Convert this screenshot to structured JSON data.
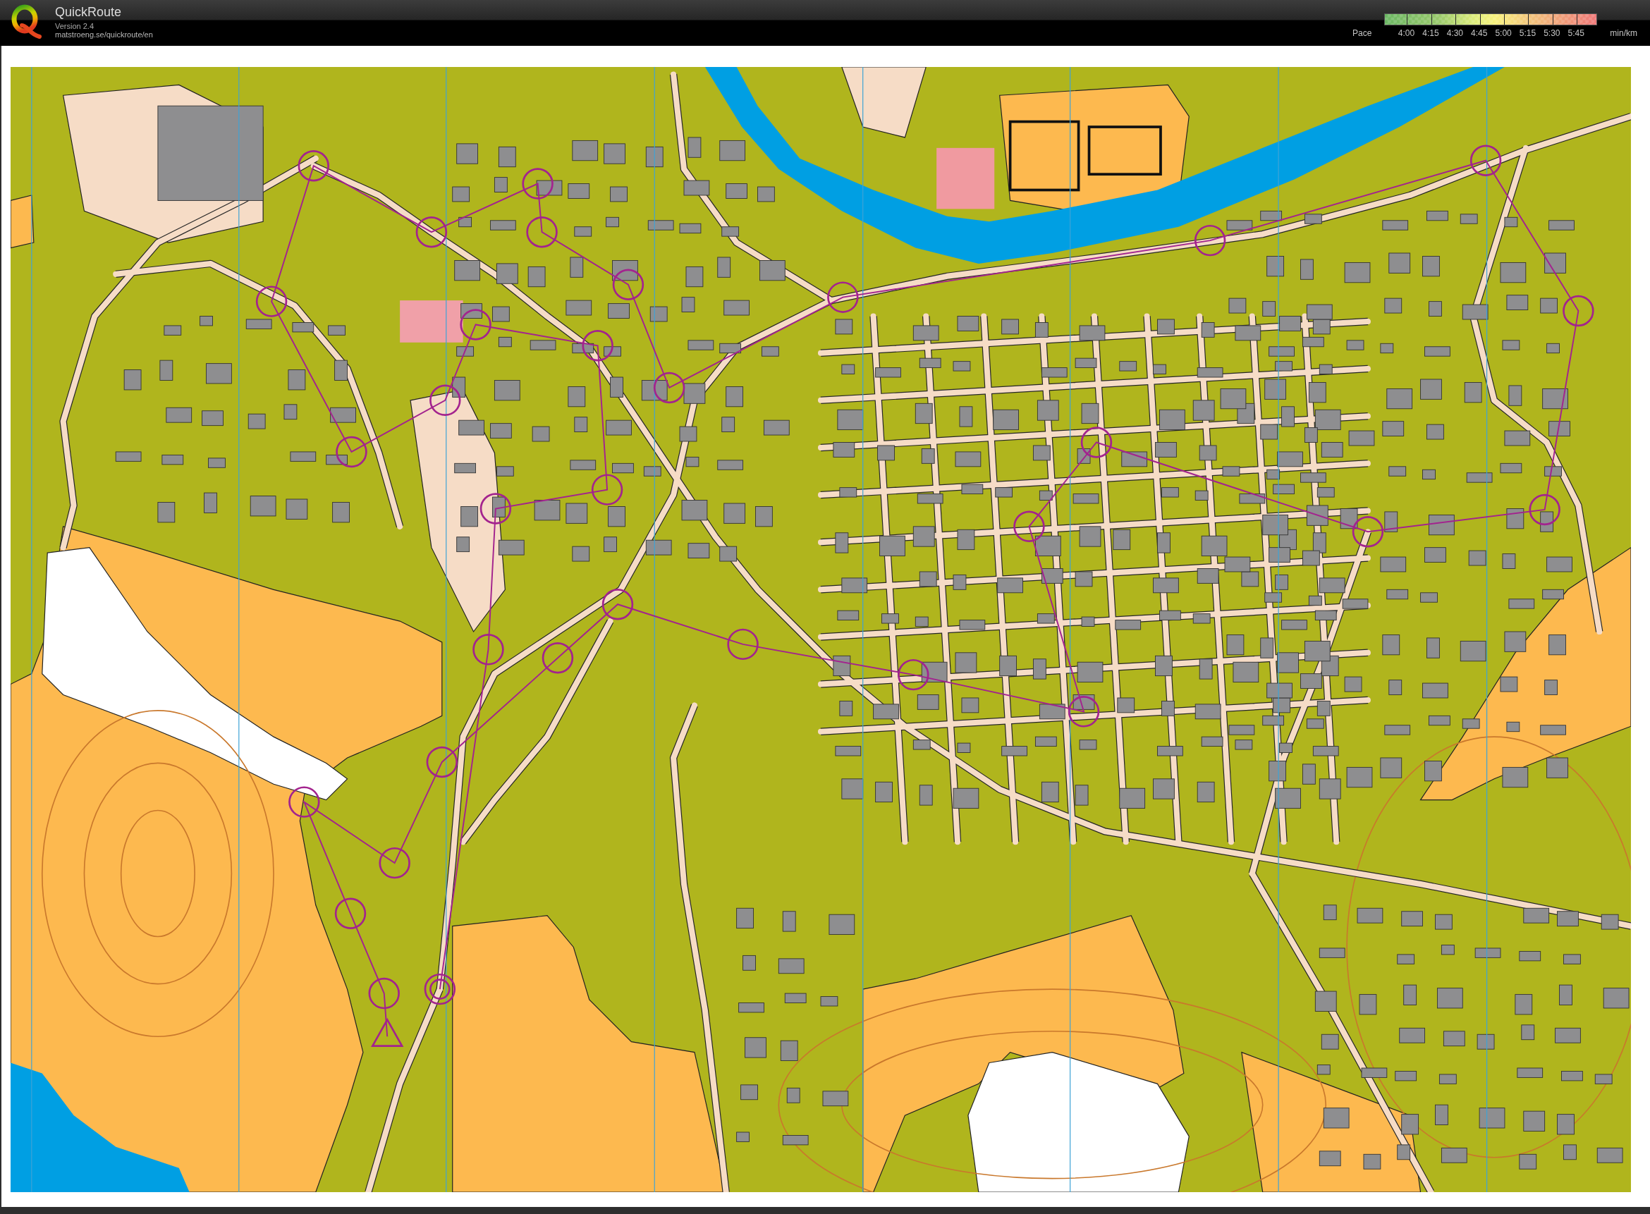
{
  "header": {
    "app_name": "QuickRoute",
    "version": "Version 2.4",
    "url": "matstroeng.se/quickroute/en"
  },
  "pace_legend": {
    "label": "Pace",
    "ticks": [
      "4:00",
      "4:15",
      "4:30",
      "4:45",
      "5:00",
      "5:15",
      "5:30",
      "5:45"
    ],
    "unit": "min/km"
  }
}
